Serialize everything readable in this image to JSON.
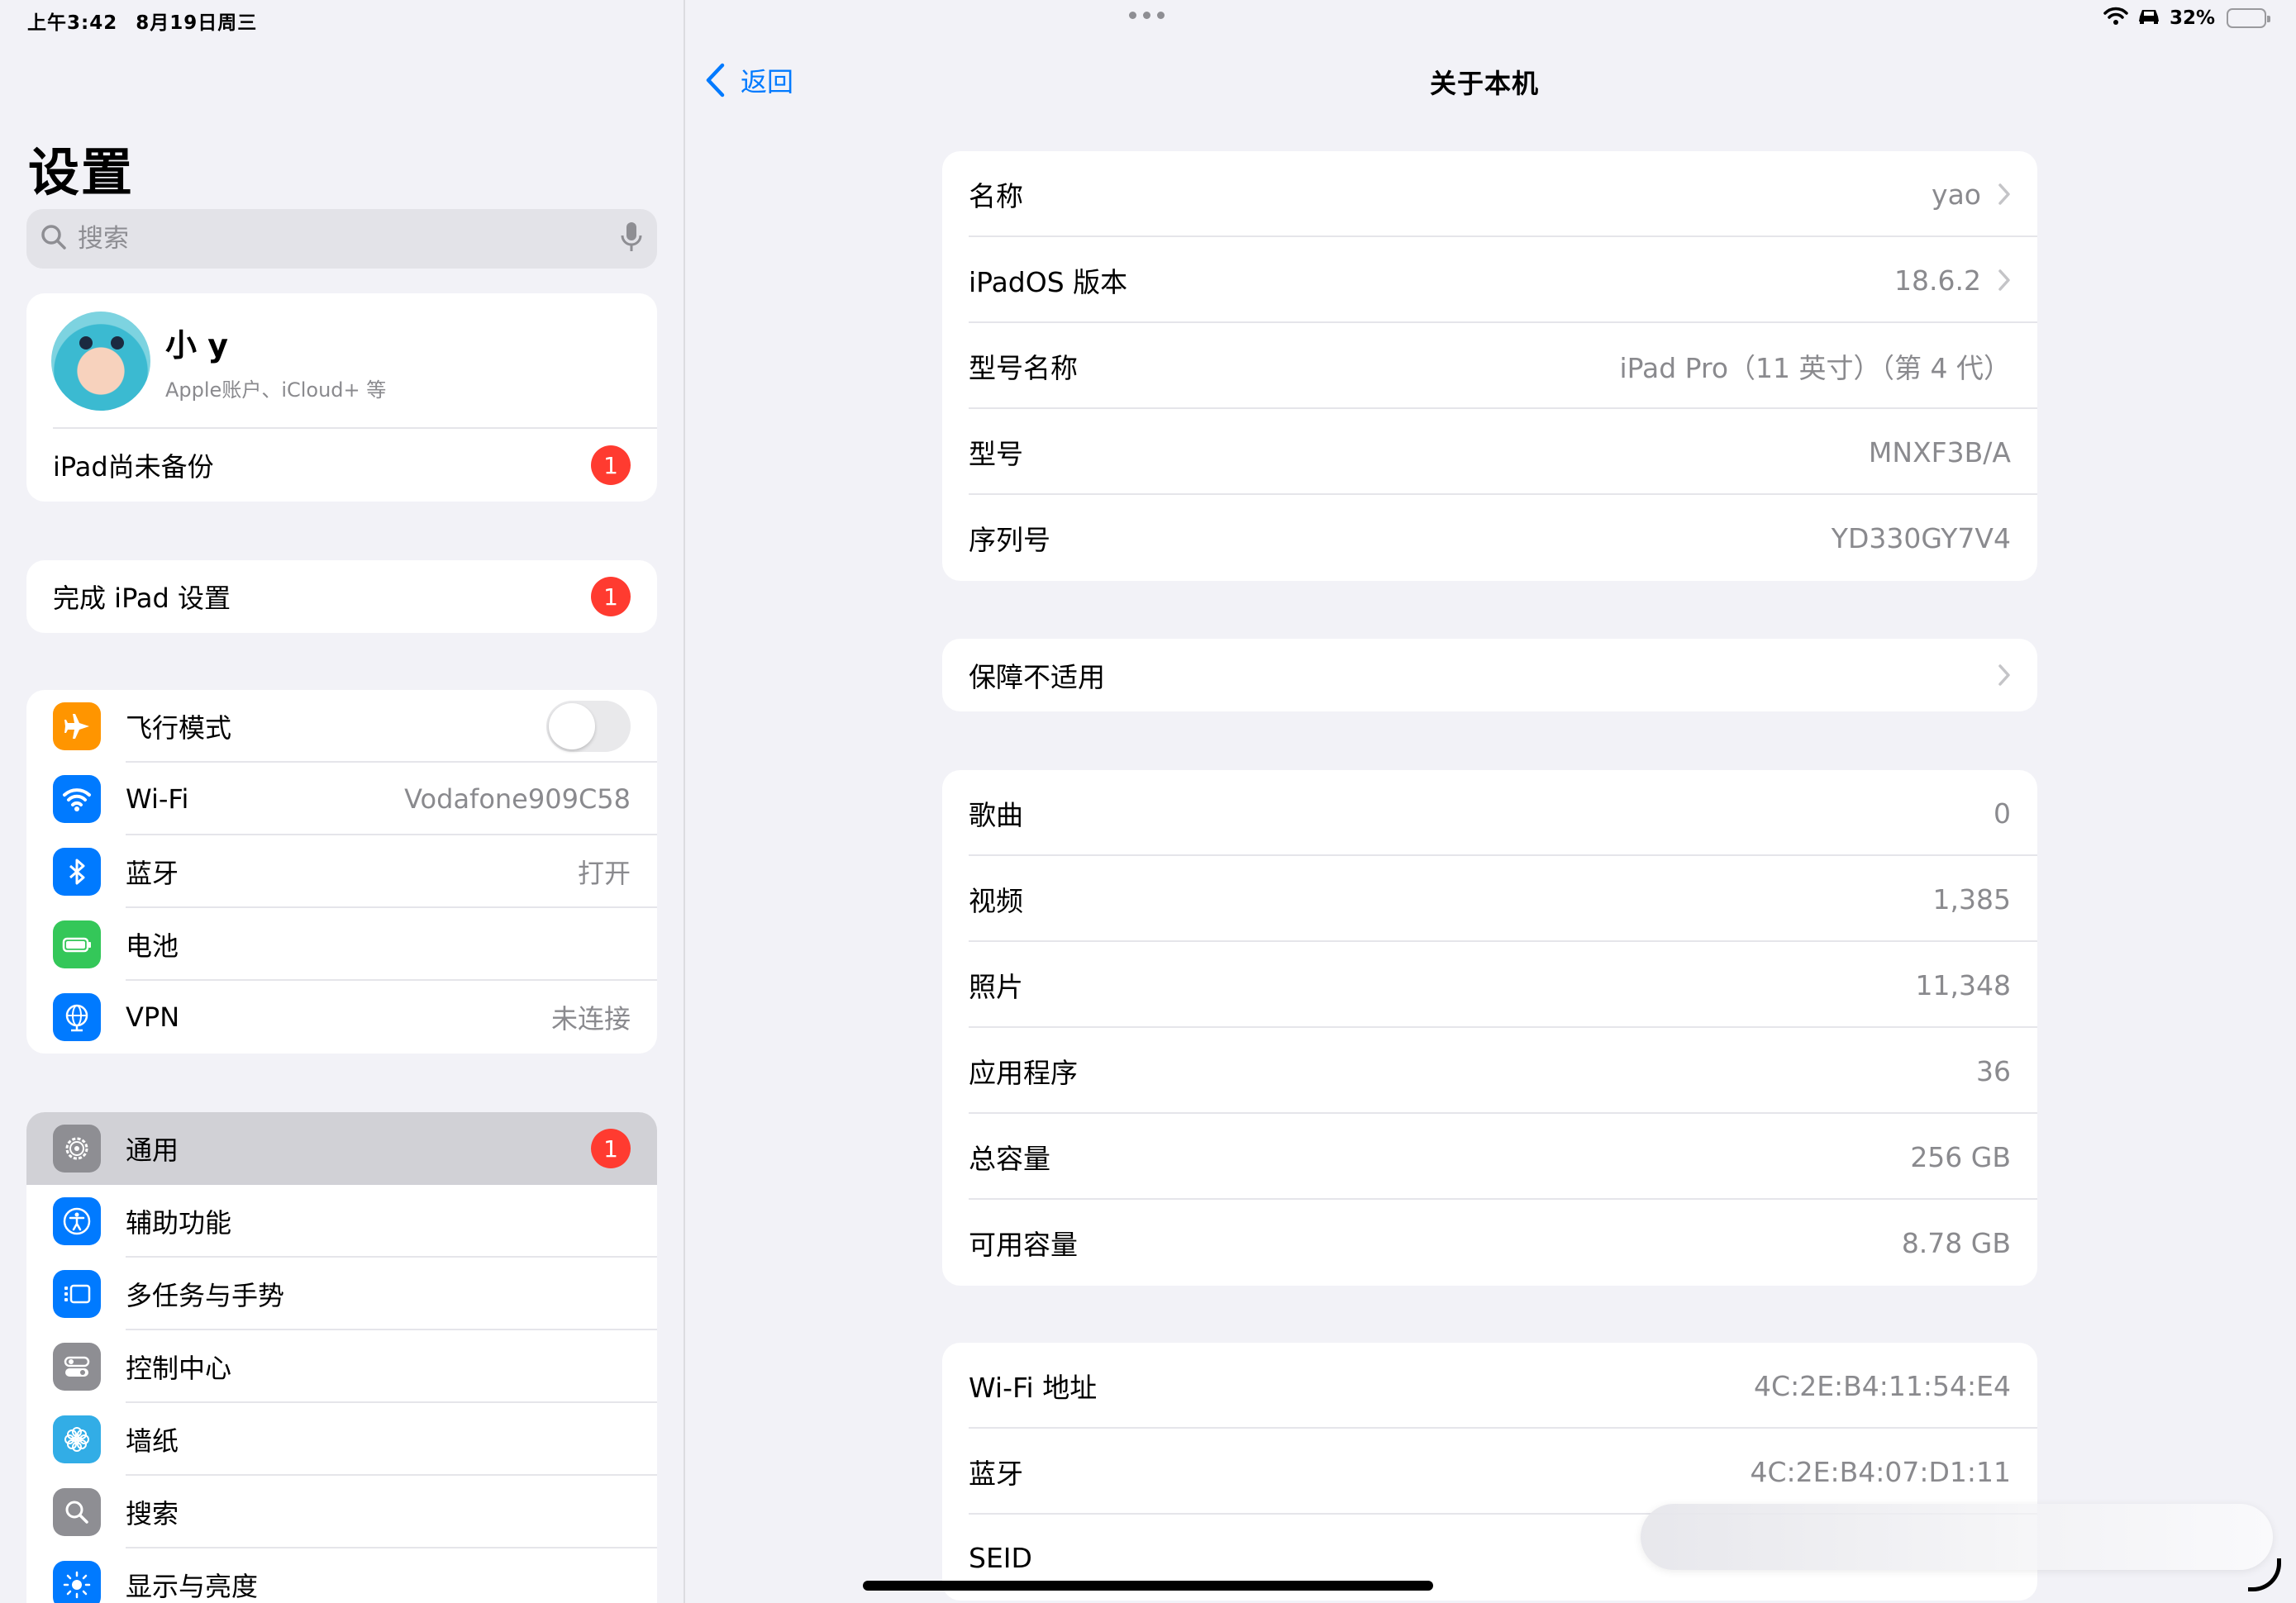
{
  "status_bar": {
    "time": "上午3:42",
    "date": "8月19日周三",
    "battery_percent": "32%",
    "battery_level": 0.32
  },
  "sidebar": {
    "title": "设置",
    "search_placeholder": "搜索",
    "profile": {
      "name": "小 y",
      "subtitle": "Apple账户、iCloud+ 等"
    },
    "backup": {
      "label": "iPad尚未备份",
      "badge": "1"
    },
    "setup": {
      "label": "完成 iPad 设置",
      "badge": "1"
    },
    "connectivity": [
      {
        "label": "飞行模式",
        "icon": "airplane-icon",
        "color": "#ff9500",
        "value": "",
        "toggle": false
      },
      {
        "label": "Wi-Fi",
        "icon": "wifi-icon",
        "color": "#007aff",
        "value": "Vodafone909C58"
      },
      {
        "label": "蓝牙",
        "icon": "bluetooth-icon",
        "color": "#007aff",
        "value": "打开"
      },
      {
        "label": "电池",
        "icon": "battery-icon",
        "color": "#34c759",
        "value": ""
      },
      {
        "label": "VPN",
        "icon": "globe-icon",
        "color": "#007aff",
        "value": "未连接"
      }
    ],
    "system": [
      {
        "label": "通用",
        "icon": "gear-icon",
        "color": "#8e8e93",
        "badge": "1",
        "selected": true
      },
      {
        "label": "辅助功能",
        "icon": "accessibility-icon",
        "color": "#007aff"
      },
      {
        "label": "多任务与手势",
        "icon": "multitasking-icon",
        "color": "#007aff"
      },
      {
        "label": "控制中心",
        "icon": "control-center-icon",
        "color": "#8e8e93"
      },
      {
        "label": "墙纸",
        "icon": "flower-icon",
        "color": "#32ade6"
      },
      {
        "label": "搜索",
        "icon": "search-icon",
        "color": "#8e8e93"
      },
      {
        "label": "显示与亮度",
        "icon": "sun-icon",
        "color": "#007aff"
      }
    ]
  },
  "detail": {
    "back_label": "返回",
    "title": "关于本机",
    "group1": [
      {
        "label": "名称",
        "value": "yao",
        "chevron": true
      },
      {
        "label": "iPadOS 版本",
        "value": "18.6.2",
        "chevron": true
      },
      {
        "label": "型号名称",
        "value": "iPad Pro（11 英寸）（第 4 代）"
      },
      {
        "label": "型号",
        "value": "MNXF3B/A"
      },
      {
        "label": "序列号",
        "value": "YD330GY7V4"
      }
    ],
    "group2": [
      {
        "label": "保障不适用",
        "value": "",
        "chevron": true
      }
    ],
    "group3": [
      {
        "label": "歌曲",
        "value": "0"
      },
      {
        "label": "视频",
        "value": "1,385"
      },
      {
        "label": "照片",
        "value": "11,348"
      },
      {
        "label": "应用程序",
        "value": "36"
      },
      {
        "label": "总容量",
        "value": "256 GB"
      },
      {
        "label": "可用容量",
        "value": "8.78 GB"
      }
    ],
    "group4": [
      {
        "label": "Wi-Fi 地址",
        "value": "4C:2E:B4:11:54:E4"
      },
      {
        "label": "蓝牙",
        "value": "4C:2E:B4:07:D1:11"
      },
      {
        "label": "SEID",
        "value": ""
      }
    ]
  }
}
